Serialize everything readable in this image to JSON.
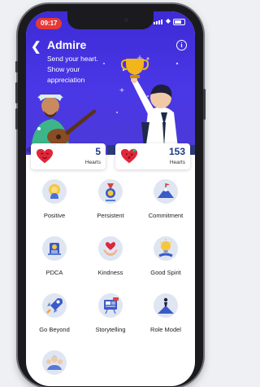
{
  "status_bar": {
    "time": "09:17"
  },
  "header": {
    "title": "Admire",
    "subtitle_line1": "Send your heart.",
    "subtitle_line2": "Show your",
    "subtitle_line3": "appreciation"
  },
  "stats": [
    {
      "value": "5",
      "label": "Hearts"
    },
    {
      "value": "153",
      "label": "Hearts"
    }
  ],
  "badges": [
    {
      "label": "Positive",
      "icon": "head-sun-icon"
    },
    {
      "label": "Persistent",
      "icon": "medal-icon"
    },
    {
      "label": "Commitment",
      "icon": "mountain-flag-icon"
    },
    {
      "label": "PDCA",
      "icon": "gear-lightbulb-icon"
    },
    {
      "label": "Kindness",
      "icon": "hands-heart-icon"
    },
    {
      "label": "Good Spirit",
      "icon": "lightbulb-hand-icon"
    },
    {
      "label": "Go Beyond",
      "icon": "rocket-icon"
    },
    {
      "label": "Storytelling",
      "icon": "storyboard-icon"
    },
    {
      "label": "Role Model",
      "icon": "person-summit-icon"
    },
    {
      "label": "",
      "icon": "people-group-icon"
    }
  ],
  "colors": {
    "hero_blue": "#4a37e6",
    "number_navy": "#1e3a8a",
    "time_pill": "#e53935",
    "badge_bg": "#dfe6f2"
  }
}
